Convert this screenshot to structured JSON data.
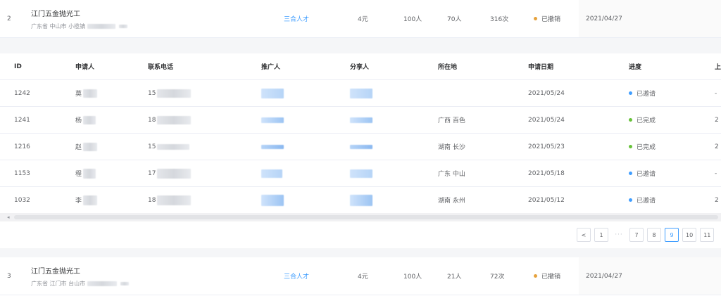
{
  "job_rows": [
    {
      "index": "2",
      "title": "江门五金抛光工",
      "address": "广东省 中山市 小榄镇",
      "type": "三合人才",
      "price": "4元",
      "needed": "100人",
      "applied": "70人",
      "views": "316次",
      "status": "已撤销",
      "status_color": "#e6a23c",
      "date": "2021/04/27"
    },
    {
      "index": "3",
      "title": "江门五金抛光工",
      "address": "广东省 江门市 台山市",
      "type": "三合人才",
      "price": "4元",
      "needed": "100人",
      "applied": "21人",
      "views": "72次",
      "status": "已撤销",
      "status_color": "#e6a23c",
      "date": "2021/04/27"
    }
  ],
  "applicants": {
    "headers": {
      "id": "ID",
      "name": "申请人",
      "phone": "联系电话",
      "promoter": "推广人",
      "sharer": "分享人",
      "location": "所在地",
      "date": "申请日期",
      "progress": "进度",
      "last": "上"
    },
    "rows": [
      {
        "id": "1242",
        "name": "莫",
        "phone": "15",
        "location": "",
        "date": "2021/05/24",
        "progress": "已邀请",
        "progress_color": "#409eff",
        "last": "-"
      },
      {
        "id": "1241",
        "name": "杨",
        "phone": "18",
        "location": "广西 百色",
        "date": "2021/05/24",
        "progress": "已完成",
        "progress_color": "#67c23a",
        "last": "2"
      },
      {
        "id": "1216",
        "name": "赵",
        "phone": "15",
        "location": "湖南 长沙",
        "date": "2021/05/23",
        "progress": "已完成",
        "progress_color": "#67c23a",
        "last": "2"
      },
      {
        "id": "1153",
        "name": "程",
        "phone": "17",
        "location": "广东 中山",
        "date": "2021/05/18",
        "progress": "已邀请",
        "progress_color": "#409eff",
        "last": "-"
      },
      {
        "id": "1032",
        "name": "李",
        "phone": "18",
        "location": "湖南 永州",
        "date": "2021/05/12",
        "progress": "已邀请",
        "progress_color": "#409eff",
        "last": "2"
      }
    ]
  },
  "scrollbar": {
    "left_arrow": "◂"
  },
  "pagination": {
    "prev": "<",
    "pages": [
      "1",
      "7",
      "8",
      "9",
      "10",
      "11"
    ],
    "ellipsis": "···",
    "current": "9"
  }
}
